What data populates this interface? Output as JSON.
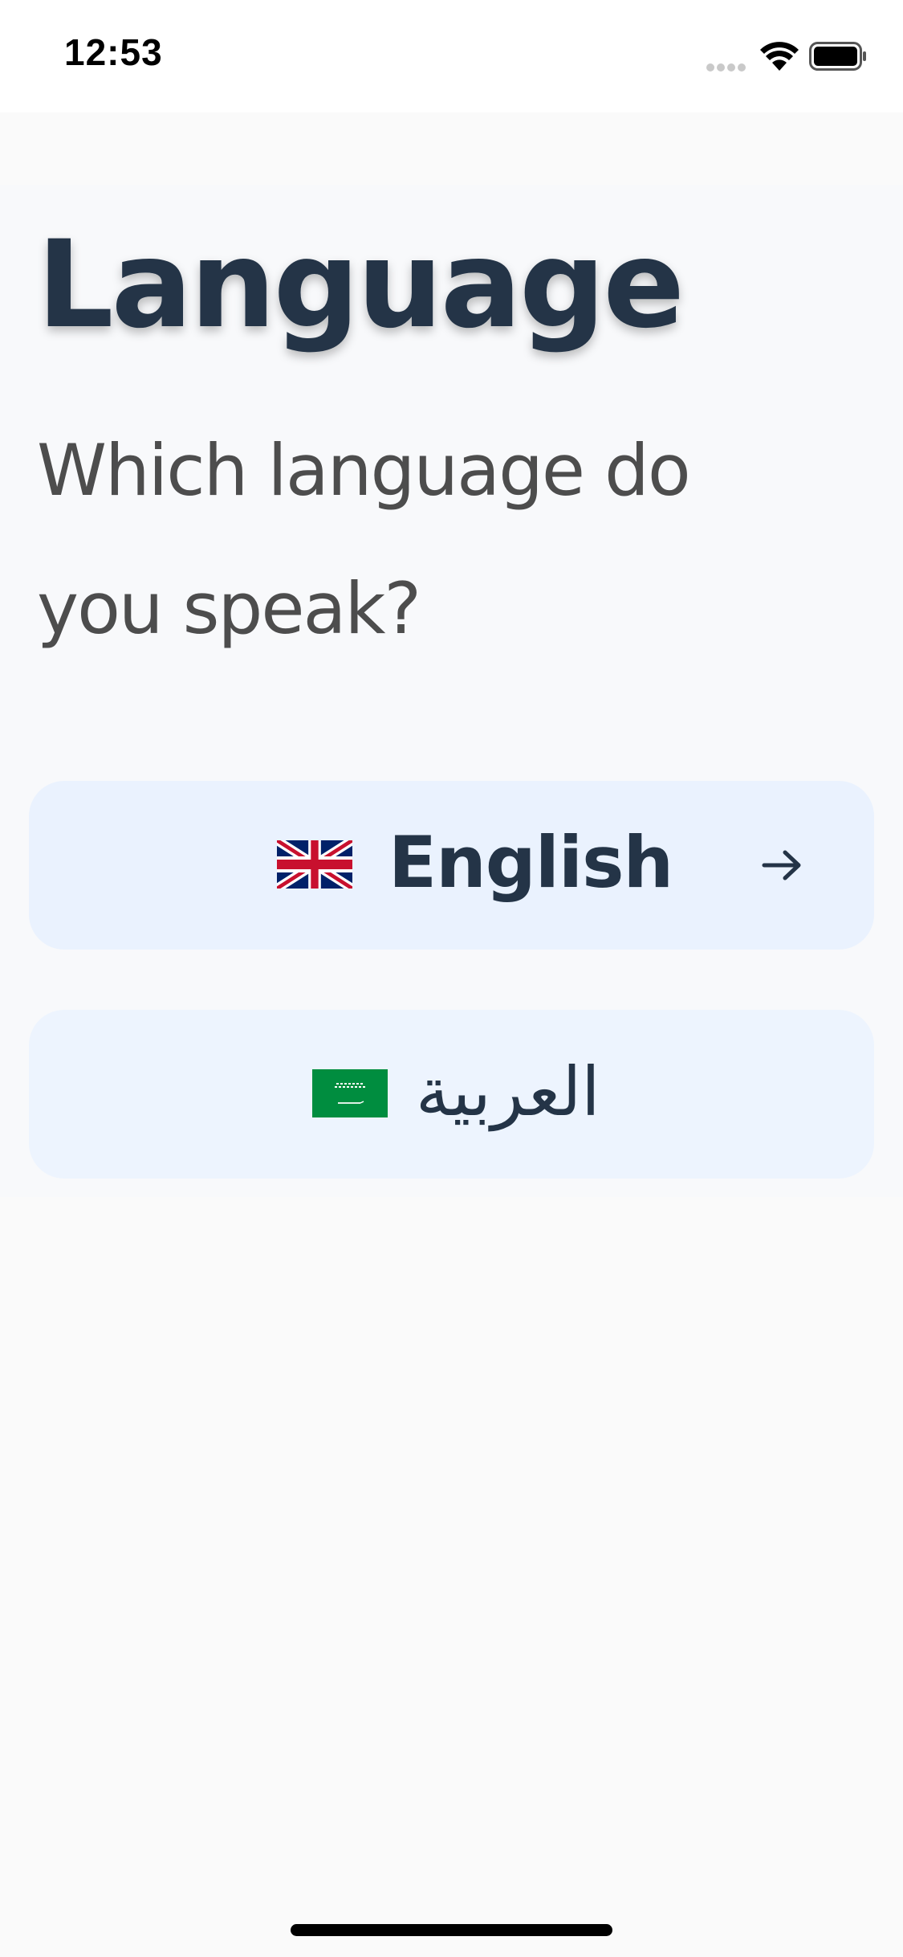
{
  "status_bar": {
    "time": "12:53"
  },
  "page": {
    "title": "Language",
    "subtitle_line1": "Which language do",
    "subtitle_line2": "you speak?"
  },
  "languages": [
    {
      "label": "English",
      "flag": "uk-flag-icon",
      "show_arrow": true
    },
    {
      "label": "العربية",
      "flag": "saudi-flag-icon",
      "show_arrow": false
    }
  ],
  "colors": {
    "title": "#243447",
    "button_background": "#eaf2fe",
    "saudi_green": "#008d3f"
  }
}
